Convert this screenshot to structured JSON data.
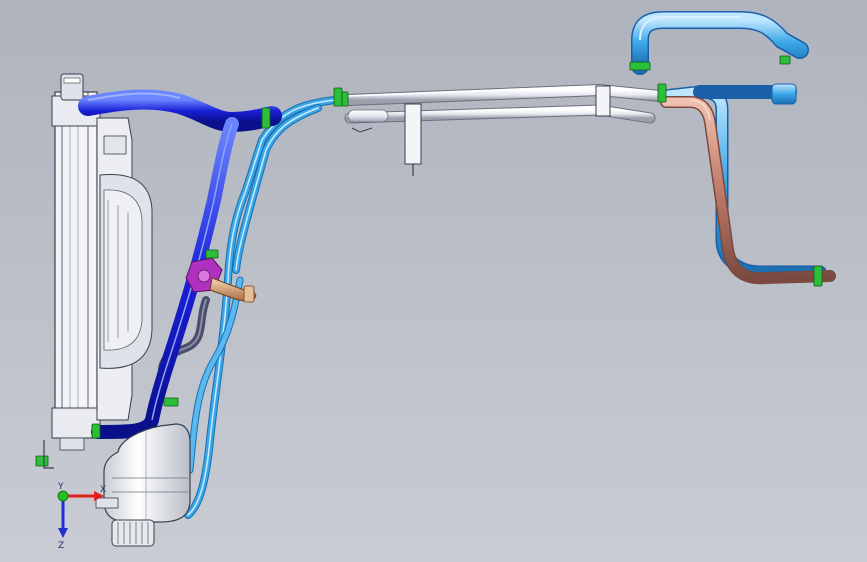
{
  "viewport": {
    "background_top": "#aeb3bd",
    "background_bottom": "#c9ccd3"
  },
  "colors": {
    "radiator_frame": "#eef0f4",
    "radiator_outline": "#3a3f4a",
    "upper_radiator_hose": "#1a20d8",
    "coolant_lines": "#3aa6e8",
    "heater_return_hose": "#4a8fd6",
    "heater_supply_hose": "#c07a68",
    "metal_pipe": "#e8ebf0",
    "reservoir": "#f1f2f5",
    "clamps": "#2bbf3a",
    "thermostat_housing": "#b030c0",
    "outlet_fitting": "#d9a070",
    "vent_hose": "#4a4e6a"
  },
  "triad": {
    "x_label": "X",
    "y_label": "Y",
    "z_label": "Z",
    "x_color": "#e02020",
    "y_color": "#20c020",
    "z_color": "#2030d0"
  }
}
